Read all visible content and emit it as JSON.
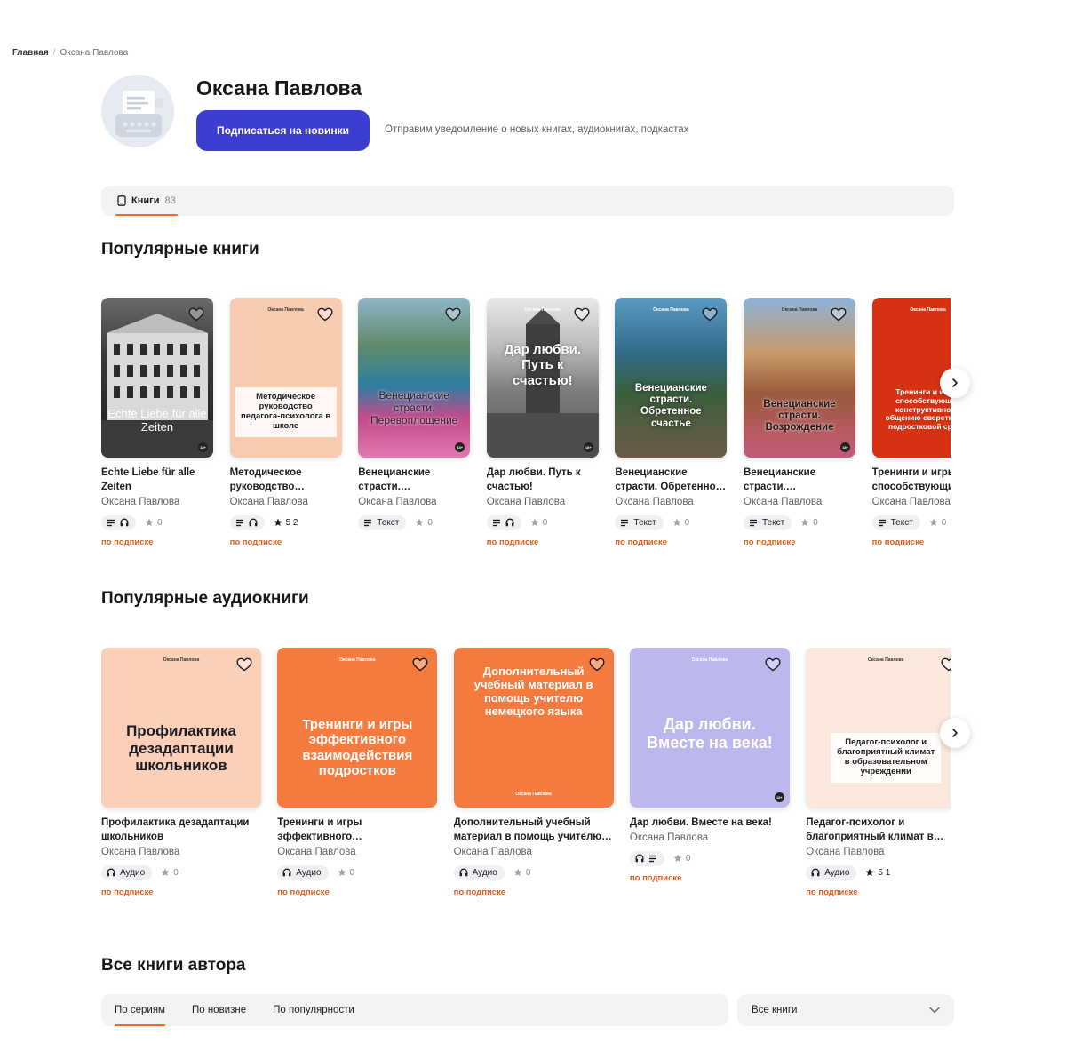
{
  "breadcrumb": {
    "home": "Главная",
    "separator": "/",
    "current": "Оксана Павлова"
  },
  "author": {
    "name": "Оксана Павлова",
    "subscribe_label": "Подписаться на новинки",
    "subscribe_note": "Отправим уведомление о новых книгах, аудиокнигах, подкастах"
  },
  "tabs": {
    "books_label": "Книги",
    "books_count": "83"
  },
  "colors": {
    "accent": "#f26a24",
    "primary_button": "#3d3dd1",
    "subscription_text": "#e0601d"
  },
  "popular_books": {
    "title": "Популярные книги",
    "items": [
      {
        "title": "Echte Liebe für alle Zeiten",
        "author": "Оксана Павлова",
        "type": "text-audio",
        "type_label": "",
        "rating": "0",
        "subscription": "по подписке",
        "cover_text": "Echte Liebe für alle Zeiten",
        "cover_author": "",
        "age": "18+"
      },
      {
        "title": "Методическое руководство…",
        "author": "Оксана Павлова",
        "type": "text-audio",
        "type_label": "",
        "rating": "5 2",
        "subscription": "по подписке",
        "cover_text": "Методическое руководство педагога-психолога в школе",
        "cover_author": "Оксана Павлова",
        "age": ""
      },
      {
        "title": "Венецианские страсти.…",
        "author": "Оксана Павлова",
        "type": "text",
        "type_label": "Текст",
        "rating": "0",
        "subscription": "",
        "cover_text": "Венецианские страсти. Перевоплощение",
        "cover_author": "",
        "age": "18+"
      },
      {
        "title": "Дар любви. Путь к счастью!",
        "author": "Оксана Павлова",
        "type": "text-audio",
        "type_label": "",
        "rating": "0",
        "subscription": "по подписке",
        "cover_text": "Дар любви. Путь к счастью!",
        "cover_author": "Оксана Павлова",
        "age": "18+"
      },
      {
        "title": "Венецианские страсти. Обретенно…",
        "author": "Оксана Павлова",
        "type": "text",
        "type_label": "Текст",
        "rating": "0",
        "subscription": "по подписке",
        "cover_text": "Венецианские страсти. Обретенное счастье",
        "cover_author": "Оксана Павлова",
        "age": ""
      },
      {
        "title": "Венецианские страсти.…",
        "author": "Оксана Павлова",
        "type": "text",
        "type_label": "Текст",
        "rating": "0",
        "subscription": "по подписке",
        "cover_text": "Венецианские страсти. Возрождение",
        "cover_author": "Оксана Павлова",
        "age": "18+"
      },
      {
        "title": "Тренинги и игры, способствующие…",
        "author": "Оксана Павлова",
        "type": "text",
        "type_label": "Текст",
        "rating": "0",
        "subscription": "по подписке",
        "cover_text": "Тренинги и игры, способствующие конструктивному общению сверстников подростковой среды",
        "cover_author": "Оксана Павлова",
        "age": ""
      }
    ]
  },
  "popular_audiobooks": {
    "title": "Популярные аудиокниги",
    "items": [
      {
        "title": "Профилактика дезадаптации школьников",
        "author": "Оксана Павлова",
        "type": "audio",
        "type_label": "Аудио",
        "rating": "0",
        "subscription": "по подписке",
        "cover_text": "Профилактика дезадаптации школьников",
        "cover_author": "Оксана Павлова",
        "age": ""
      },
      {
        "title": "Тренинги и игры эффективного…",
        "author": "Оксана Павлова",
        "type": "audio",
        "type_label": "Аудио",
        "rating": "0",
        "subscription": "по подписке",
        "cover_text": "Тренинги и игры эффективного взаимодействия подростков",
        "cover_author": "Оксана Павлова",
        "age": ""
      },
      {
        "title": "Дополнительный учебный материал в помощь учителю…",
        "author": "Оксана Павлова",
        "type": "audio",
        "type_label": "Аудио",
        "rating": "0",
        "subscription": "по подписке",
        "cover_text": "Дополнительный учебный материал в помощь учителю немецкого языка",
        "cover_author": "Оксана Павлова",
        "age": ""
      },
      {
        "title": "Дар любви. Вместе на века!",
        "author": "Оксана Павлова",
        "type": "audio-text",
        "type_label": "",
        "rating": "0",
        "subscription": "по подписке",
        "cover_text": "Дар любви. Вместе на века!",
        "cover_author": "Оксана Павлова",
        "age": "18+"
      },
      {
        "title": "Педагог-психолог и благоприятный климат в…",
        "author": "Оксана Павлова",
        "type": "audio",
        "type_label": "Аудио",
        "rating": "5 1",
        "subscription": "по подписке",
        "cover_text": "Педагог-психолог и благоприятный климат в образовательном учреждении",
        "cover_author": "Оксана Павлова",
        "age": ""
      }
    ]
  },
  "all_books": {
    "title": "Все книги автора",
    "filters": [
      "По сериям",
      "По новизне",
      "По популярности"
    ],
    "select_value": "Все книги"
  }
}
